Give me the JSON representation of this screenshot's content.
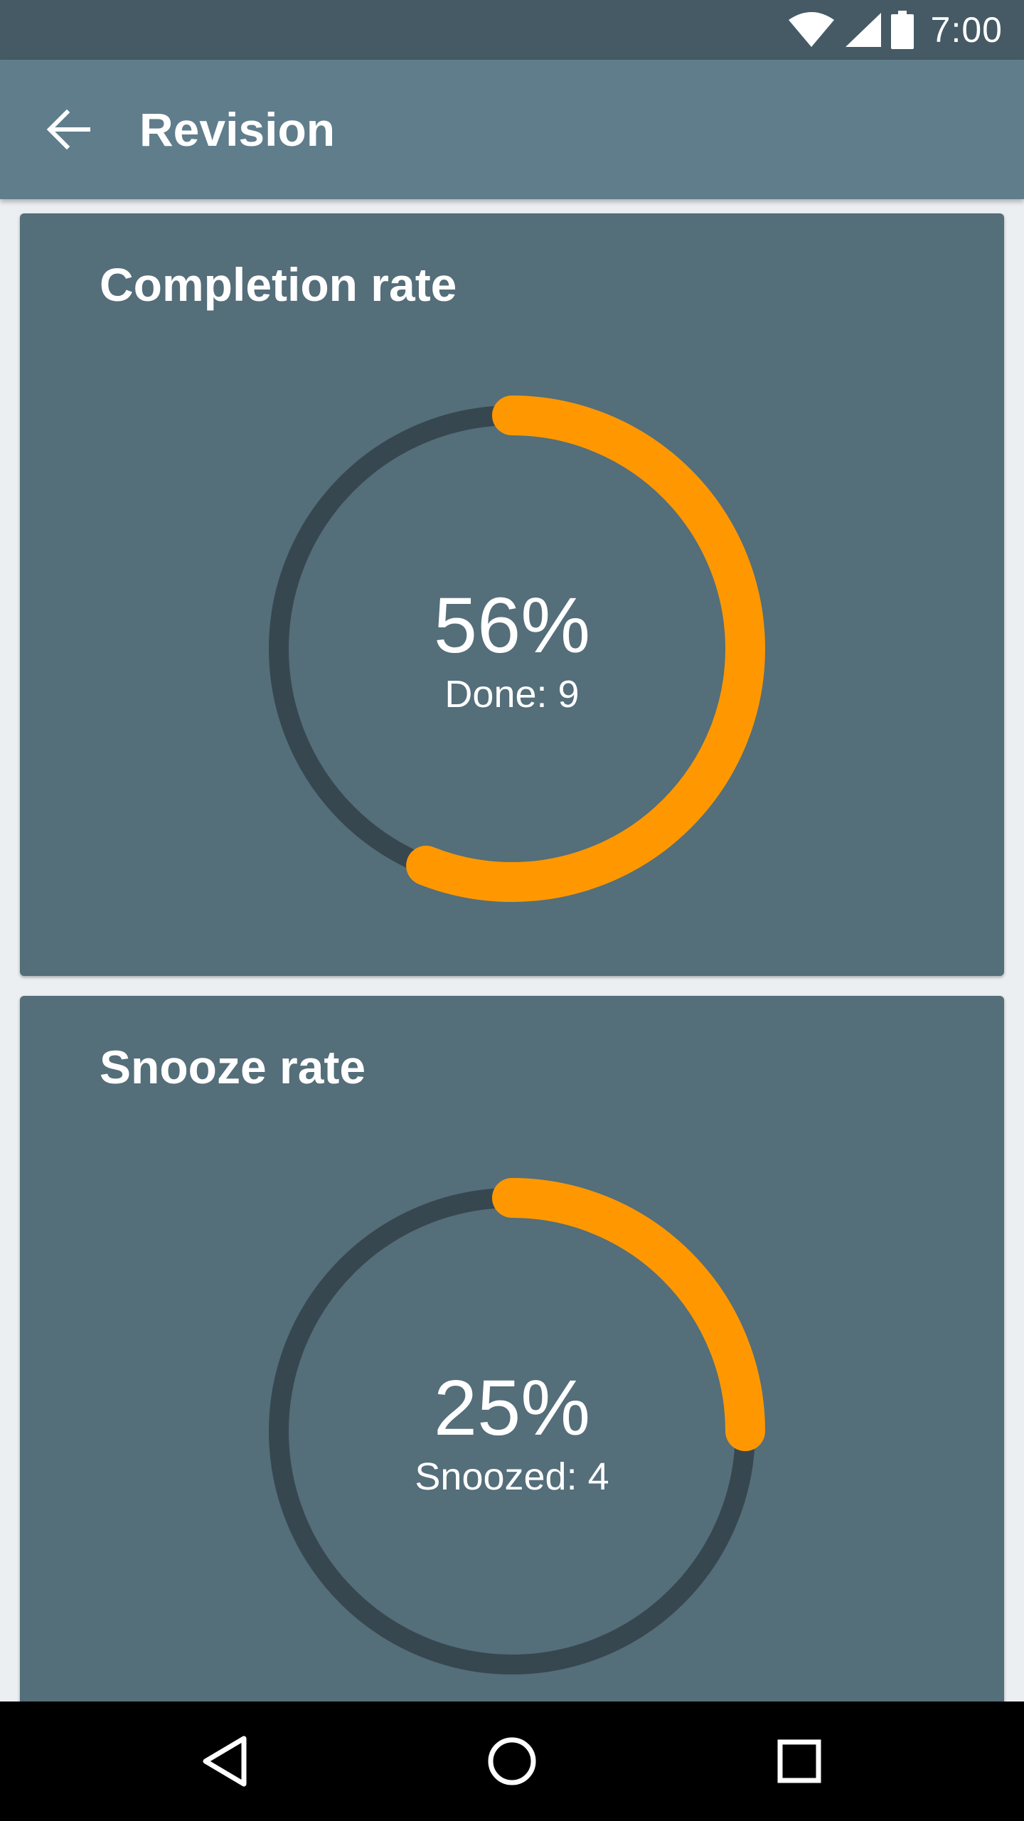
{
  "status_bar": {
    "time": "7:00",
    "icons": [
      "wifi-icon",
      "signal-icon",
      "battery-icon"
    ]
  },
  "app_bar": {
    "title": "Revision",
    "back_icon": "arrow-back-icon"
  },
  "cards": [
    {
      "title": "Completion rate",
      "percent_text": "56%",
      "detail_text": "Done: 9",
      "progress": 0.56
    },
    {
      "title": "Snooze rate",
      "percent_text": "25%",
      "detail_text": "Snoozed: 4",
      "progress": 0.25
    }
  ],
  "colors": {
    "accent": "#ff9800",
    "track": "#37474f",
    "card": "#546e7a",
    "app_bar": "#607d8b",
    "status_bar": "#455a64"
  },
  "nav_bar": {
    "icons": [
      "back-triangle-icon",
      "home-circle-icon",
      "recents-square-icon"
    ]
  }
}
